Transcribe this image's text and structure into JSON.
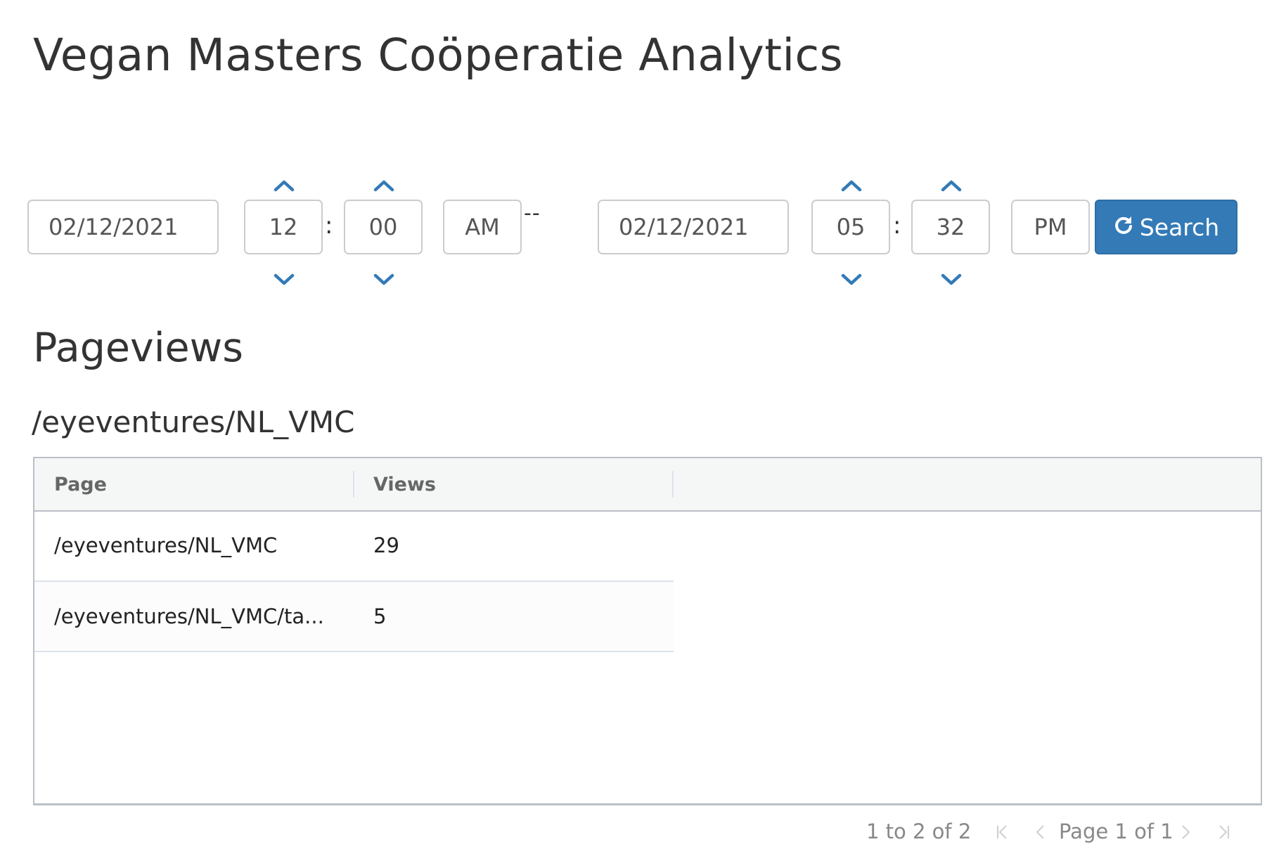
{
  "title": "Vegan Masters Coöperatie Analytics",
  "filters": {
    "start": {
      "date": "02/12/2021",
      "hour": "12",
      "minute": "00",
      "ampm": "AM"
    },
    "separator": "--",
    "colon": ":",
    "end": {
      "date": "02/12/2021",
      "hour": "05",
      "minute": "32",
      "ampm": "PM"
    },
    "search_label": "Search"
  },
  "section_title": "Pageviews",
  "subsection_title": "/eyeventures/NL_VMC",
  "table": {
    "columns": [
      "Page",
      "Views"
    ],
    "rows": [
      {
        "page": "/eyeventures/NL_VMC",
        "views": "29"
      },
      {
        "page": "/eyeventures/NL_VMC/ta...",
        "views": "5"
      }
    ]
  },
  "pagination": {
    "summary": "1 to 2 of 2",
    "page_label": "Page 1 of 1"
  },
  "colors": {
    "accent": "#337ab7",
    "header_bg": "#f5f7f7",
    "border": "#babfc7",
    "muted_text": "#888888"
  },
  "icons": [
    "chevron-up-icon",
    "chevron-down-icon",
    "refresh-icon",
    "first-page-icon",
    "previous-page-icon",
    "next-page-icon",
    "last-page-icon"
  ]
}
